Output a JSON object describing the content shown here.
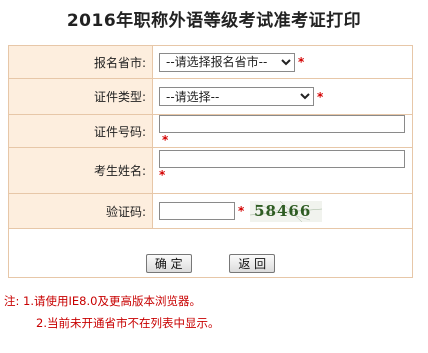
{
  "title": "2016年职称外语等级考试准考证打印",
  "form": {
    "province_label": "报名省市:",
    "province_value": "--请选择报名省市--",
    "id_type_label": "证件类型:",
    "id_type_value": "--请选择--",
    "id_number_label": "证件号码:",
    "id_number_value": "",
    "name_label": "考生姓名:",
    "name_value": "",
    "captcha_label": "验证码:",
    "captcha_value": "",
    "captcha_image_text": "58466",
    "required_mark": "*"
  },
  "buttons": {
    "confirm": "确 定",
    "back": "返 回"
  },
  "notes": {
    "line1": "注: 1.请使用IE8.0及更高版本浏览器。",
    "line2": "2.当前未开通省市不在列表中显示。"
  }
}
